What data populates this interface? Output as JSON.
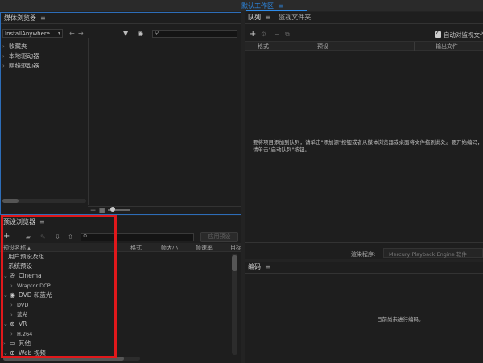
{
  "top_strip": {
    "workspace": "默认工作区",
    "menu_icon": "≡"
  },
  "media_browser": {
    "title": "媒体浏览器",
    "menu_icon": "≡",
    "dropdown_value": "InstallAnywhere",
    "tree": [
      "收藏夹",
      "本地驱动器",
      "网络驱动器"
    ]
  },
  "queue": {
    "tabs": [
      "队列",
      "监视文件夹"
    ],
    "auto_encode_label": "自动对监视文件",
    "columns": [
      "格式",
      "预设",
      "输出文件"
    ],
    "message": "要将项目添加到队列，请单击\"添加源\"按钮或者从媒体浏览器或桌面将文件拖到此处。要开始编码，请单击\"启动队列\"按钮。",
    "renderer_label": "渲染程序:",
    "renderer_value": "Mercury Playback Engine 软件"
  },
  "preset_browser": {
    "title": "预设浏览器",
    "menu_icon": "≡",
    "apply_button": "应用预设",
    "columns": [
      "预设名称",
      "格式",
      "帧大小",
      "帧速率",
      "目标"
    ],
    "rows": [
      {
        "label": "用户预设及组",
        "level": 0,
        "caret": "",
        "icon": ""
      },
      {
        "label": "系统预设",
        "level": 0,
        "caret": "",
        "icon": ""
      },
      {
        "label": "Cinema",
        "level": 1,
        "caret": "v",
        "icon": "cinema-icon"
      },
      {
        "label": "Wraptor DCP",
        "level": 2,
        "caret": ">",
        "icon": ""
      },
      {
        "label": "DVD 和蓝光",
        "level": 1,
        "caret": "v",
        "icon": "disc-icon"
      },
      {
        "label": "DVD",
        "level": 2,
        "caret": ">",
        "icon": ""
      },
      {
        "label": "蓝光",
        "level": 2,
        "caret": ">",
        "icon": ""
      },
      {
        "label": "VR",
        "level": 1,
        "caret": "v",
        "icon": "vr-icon"
      },
      {
        "label": "H.264",
        "level": 2,
        "caret": ">",
        "icon": ""
      },
      {
        "label": "其他",
        "level": 1,
        "caret": ">",
        "icon": "monitor-icon"
      },
      {
        "label": "Web 视频",
        "level": 1,
        "caret": "v",
        "icon": "globe-icon"
      }
    ]
  },
  "encode": {
    "title": "编码",
    "menu_icon": "≡",
    "message": "目前尚未进行编码。"
  },
  "colors": {
    "highlight_box": "#e0181b",
    "accent": "#2d8ceb"
  }
}
